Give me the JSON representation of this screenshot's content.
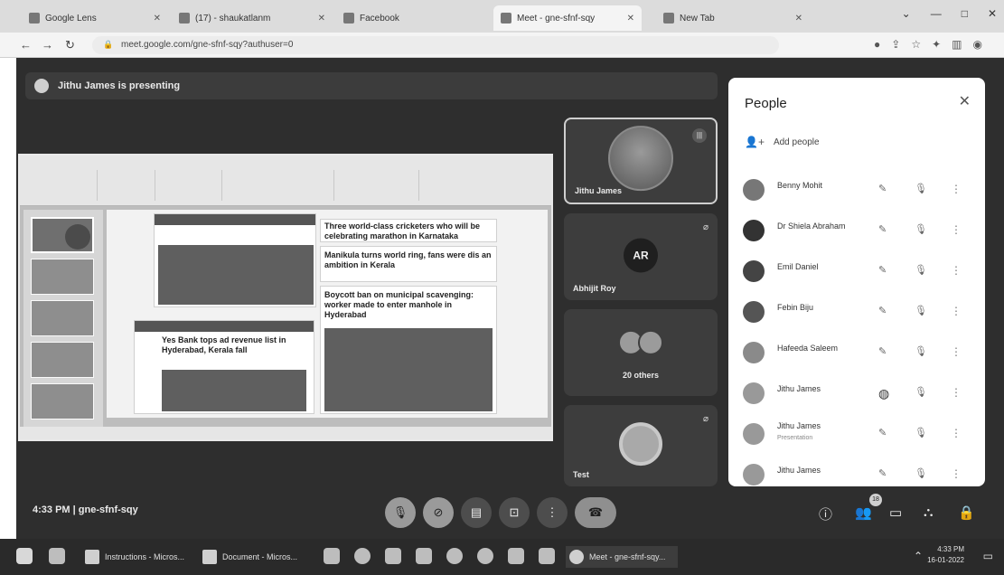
{
  "browser": {
    "tabs": [
      {
        "label": "Google Lens",
        "active": false
      },
      {
        "label": "(17) - shaukatlanm",
        "active": false
      },
      {
        "label": "Facebook",
        "active": false
      },
      {
        "label": "Meet - gne-sfnf-sqy",
        "active": true
      },
      {
        "label": "New Tab",
        "active": false
      }
    ],
    "url": "meet.google.com/gne-sfnf-sqy?authuser=0"
  },
  "meet": {
    "presenting_text": "Jithu James is presenting",
    "info": "4:33 PM  |  gne-sfnf-sqy",
    "participant_badge": "18"
  },
  "shared_screen": {
    "headlines": [
      "Three world-class cricketers who will be celebrating marathon in Karnataka",
      "Manikula turns world ring, fans were dis an ambition in Kerala",
      "Boycott ban on municipal scavenging: worker made to enter manhole in Hyderabad",
      "Yes Bank tops ad revenue list in Hyderabad, Kerala fall"
    ]
  },
  "tiles": [
    {
      "name": "Jithu James",
      "kind": "photo"
    },
    {
      "name": "Abhijit Roy",
      "initials": "AR",
      "kind": "initials"
    },
    {
      "name": "20 others",
      "kind": "group"
    },
    {
      "name": "Test",
      "kind": "tree"
    }
  ],
  "people_panel": {
    "title": "People",
    "add_label": "Add people",
    "participants": [
      {
        "name": "Benny Mohit",
        "sub": ""
      },
      {
        "name": "Dr Shiela Abraham",
        "sub": ""
      },
      {
        "name": "Emil Daniel",
        "sub": ""
      },
      {
        "name": "Febin Biju",
        "sub": ""
      },
      {
        "name": "Hafeeda Saleem",
        "sub": ""
      },
      {
        "name": "Jithu James",
        "sub": ""
      },
      {
        "name": "Jithu James",
        "sub": "Presentation"
      },
      {
        "name": "Jithu James",
        "sub": ""
      }
    ]
  },
  "taskbar": {
    "items": [
      "Instructions - Micros...",
      "Document - Micros...",
      "Meet - gne-sfnf-sqy..."
    ],
    "time": "4:33 PM",
    "date": "16-01-2022"
  },
  "colors": {
    "stage_bg": "#2e2e2e",
    "panel_bg": "#ffffff",
    "taskbar": "#2a2a2a"
  }
}
